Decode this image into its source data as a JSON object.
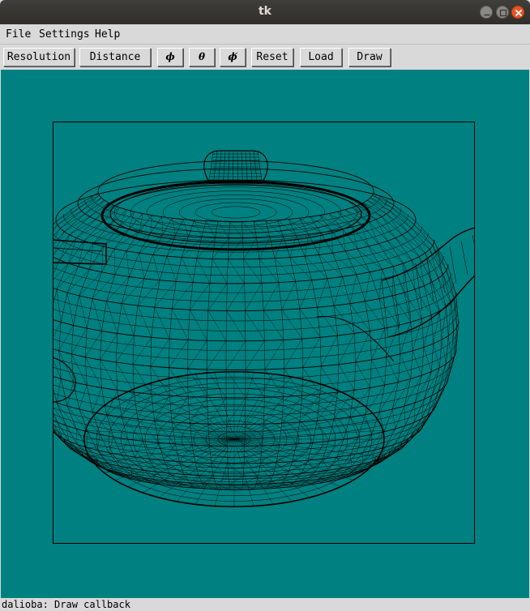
{
  "window": {
    "title": "tk"
  },
  "menubar": {
    "items": [
      {
        "label": "File"
      },
      {
        "label": "Settings"
      },
      {
        "label": "Help"
      }
    ]
  },
  "toolbar": {
    "resolution_label": "Resolution",
    "distance_label": "Distance",
    "phi_label": "ϕ",
    "theta_label": "θ",
    "psi_label": "ϕ̸",
    "reset_label": "Reset",
    "load_label": "Load",
    "draw_label": "Draw"
  },
  "canvas": {
    "background": "#008080",
    "wire_color": "#000000",
    "content": "wireframe-teapot"
  },
  "status": {
    "text": "dalioba: Draw callback"
  }
}
